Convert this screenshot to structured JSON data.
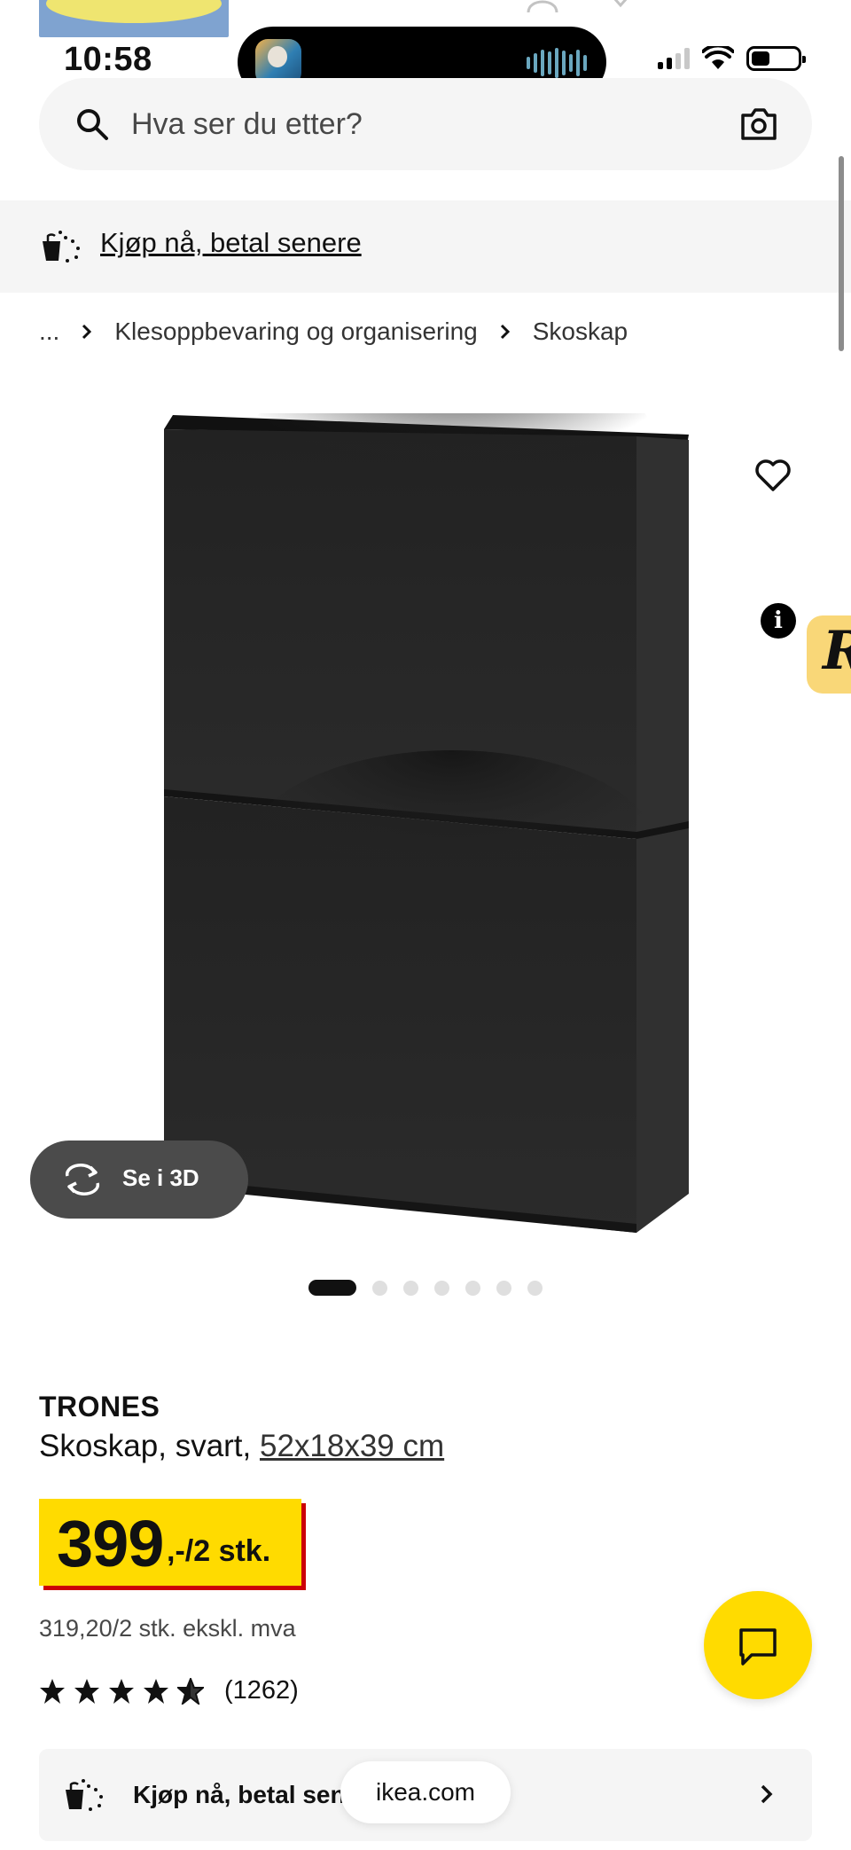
{
  "status_bar": {
    "time": "10:58"
  },
  "search": {
    "placeholder": "Hva ser du etter?"
  },
  "banner": {
    "link_text": "Kjøp nå, betal senere"
  },
  "breadcrumb": {
    "ellipsis": "...",
    "items": [
      "Klesoppbevaring og organisering",
      "Skoskap"
    ]
  },
  "product": {
    "name": "TRONES",
    "description": "Skoskap, svart, ",
    "dimensions": "52x18x39 cm",
    "image_color": "#2a2a2a"
  },
  "gallery": {
    "view3d_label": "Se i 3D",
    "image_count": 7,
    "active_index": 0
  },
  "price": {
    "integer": "399",
    "suffix": ",-/2 stk.",
    "ex_vat": "319,20/2 stk. ekskl. mva",
    "accent": "#ffdb00",
    "shadow": "#cc0008"
  },
  "rating": {
    "stars": 4.5,
    "count": "(1262)"
  },
  "extension_badge": {
    "letter": "R",
    "info": "i"
  },
  "bnpl_card": {
    "label": "Kjøp nå, betal senere"
  },
  "browser": {
    "url": "ikea.com"
  }
}
